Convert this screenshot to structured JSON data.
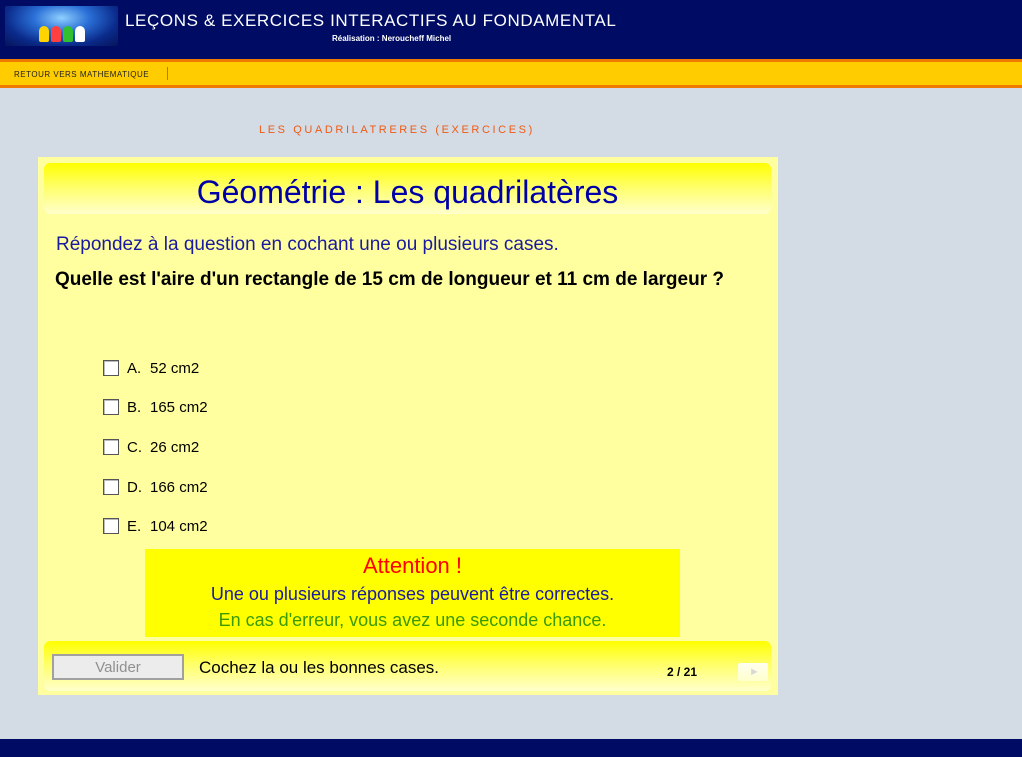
{
  "header": {
    "title": "LEÇONS & EXERCICES INTERACTIFS AU FONDAMENTAL",
    "subtitle": "Réalisation : Neroucheff Michel"
  },
  "nav": {
    "back_link": "RETOUR VERS MATHEMATIQUE"
  },
  "section_title": "LES QUADRILATRERES (EXERCICES)",
  "quiz": {
    "title": "Géométrie : Les quadrilatères",
    "instruction": "Répondez à la question en cochant une ou plusieurs cases.",
    "question": "Quelle est l'aire d'un rectangle de 15 cm de longueur et 11 cm de largeur ?",
    "options": [
      {
        "letter": "A.",
        "value": "52 cm2",
        "checked": false
      },
      {
        "letter": "B.",
        "value": "165 cm2",
        "checked": false
      },
      {
        "letter": "C.",
        "value": "26 cm2",
        "checked": false
      },
      {
        "letter": "D.",
        "value": "166 cm2",
        "checked": false
      },
      {
        "letter": "E.",
        "value": "104 cm2",
        "checked": false
      }
    ],
    "attention": {
      "heading": "Attention !",
      "line1": "Une ou plusieurs réponses peuvent être correctes.",
      "line2": "En cas d'erreur, vous avez une seconde chance."
    },
    "validate_label": "Valider",
    "hint": "Cochez la ou les bonnes cases.",
    "counter": "2 / 21",
    "next_icon": "arrow-right-icon"
  },
  "colors": {
    "header_bg": "#000c64",
    "nav_bg": "#ffcc00",
    "panel_bg": "#ffff9f",
    "title_color": "#0000a8",
    "attention_red": "#ff0000",
    "attention_green": "#3b9a00"
  }
}
